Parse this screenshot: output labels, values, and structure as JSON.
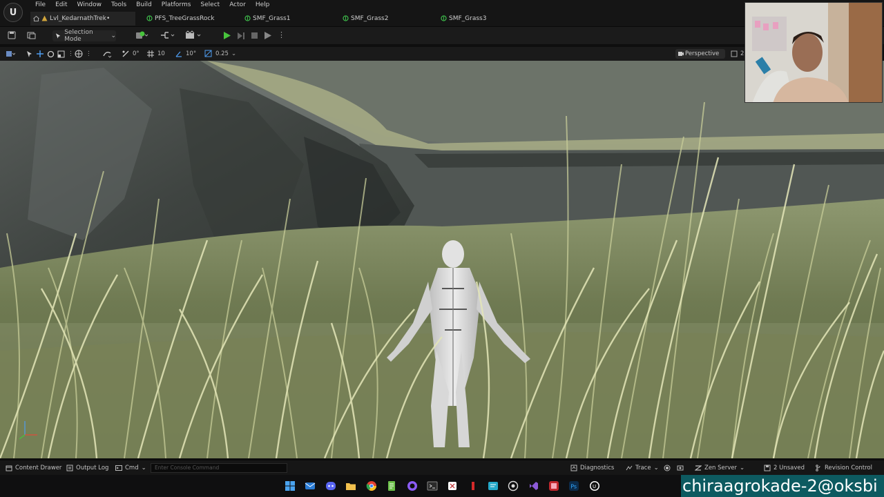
{
  "menu": [
    "File",
    "Edit",
    "Window",
    "Tools",
    "Build",
    "Platforms",
    "Select",
    "Actor",
    "Help"
  ],
  "tabs": [
    {
      "label": "Lvl_KedarnathTrek•",
      "icon": "level-icon",
      "active": true
    },
    {
      "label": "PFS_TreeGrassRock",
      "icon": "foliage-icon",
      "active": false
    },
    {
      "label": "SMF_Grass1",
      "icon": "foliage-icon",
      "active": false
    },
    {
      "label": "SMF_Grass2",
      "icon": "foliage-icon",
      "active": false
    },
    {
      "label": "SMF_Grass3",
      "icon": "foliage-icon",
      "active": false
    }
  ],
  "toolbar": {
    "mode_label": "Selection Mode"
  },
  "viewport_toolbar": {
    "rotation_snap": "0°",
    "grid_snap": "10",
    "angle_snap": "10°",
    "scale_snap": "0.25",
    "view_mode": "Perspective",
    "extra": "2"
  },
  "statusbar": {
    "content_drawer": "Content Drawer",
    "output_log": "Output Log",
    "cmd": "Cmd",
    "cmd_placeholder": "Enter Console Command",
    "diagnostics": "Diagnostics",
    "trace": "Trace",
    "zen_server": "Zen Server",
    "unsaved": "2 Unsaved",
    "revision_control": "Revision Control"
  },
  "watermark": "chiraagrokade-2@oksbi",
  "colors": {
    "accent_green": "#3dbb4a",
    "level_tab_icon": "#d0a43b",
    "play_green": "#48c43c"
  }
}
